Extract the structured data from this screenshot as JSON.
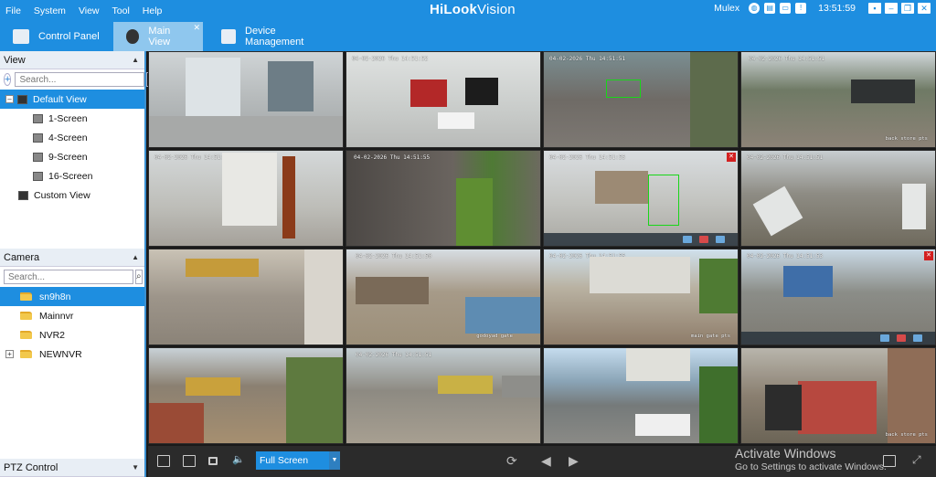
{
  "menu": [
    "File",
    "System",
    "View",
    "Tool",
    "Help"
  ],
  "brand": {
    "bold": "HiLook",
    "rest": "Vision"
  },
  "titlebar": {
    "user": "Mulex",
    "time": "13:51:59"
  },
  "tabs": [
    {
      "label": "Control Panel"
    },
    {
      "label": "Main View"
    },
    {
      "label": "Device Management"
    }
  ],
  "view_panel": {
    "title": "View",
    "search_placeholder": "Search...",
    "items": [
      "Default View",
      "1-Screen",
      "4-Screen",
      "9-Screen",
      "16-Screen",
      "Custom View"
    ]
  },
  "camera_panel": {
    "title": "Camera",
    "search_placeholder": "Search...",
    "items": [
      "sn9h8n",
      "Mainnvr",
      "NVR2",
      "NEWNVR"
    ]
  },
  "ptz_panel": {
    "title": "PTZ Control"
  },
  "cells": [
    {
      "osd": "",
      "name": ""
    },
    {
      "osd": "04-02-2026 Thu 14:51:52",
      "name": ""
    },
    {
      "osd": "04-02-2026 Thu 14:51:51",
      "name": ""
    },
    {
      "osd": "04-02-2026 Thu 14:51:51",
      "name": "back store pts"
    },
    {
      "osd": "04-02-2026 Thu 14:51:53",
      "name": ""
    },
    {
      "osd": "04-02-2026 Thu 14:51:55",
      "name": ""
    },
    {
      "osd": "04-02-2026 Thu 14:51:55",
      "name": ""
    },
    {
      "osd": "04-02-2026 Thu 14:51:51",
      "name": ""
    },
    {
      "osd": "",
      "name": ""
    },
    {
      "osd": "04-02-2026 Thu 14:51:50",
      "name": "godoyad gate"
    },
    {
      "osd": "04-02-2026 Thu 14:51:55",
      "name": "main gate pts"
    },
    {
      "osd": "04-02-2026 Thu 14:51:53",
      "name": ""
    },
    {
      "osd": "",
      "name": ""
    },
    {
      "osd": "04-02-2026 Thu 14:51:51",
      "name": ""
    },
    {
      "osd": "",
      "name": ""
    },
    {
      "osd": "",
      "name": "back store pts"
    }
  ],
  "bottombar": {
    "screen_mode": "Full Screen",
    "activate_title": "Activate Windows",
    "activate_sub": "Go to Settings to activate Windows."
  },
  "colors": {
    "accent": "#1e8ee0",
    "selection": "#1e8ee0",
    "detect": "#19d619",
    "alarm": "#d32020"
  }
}
